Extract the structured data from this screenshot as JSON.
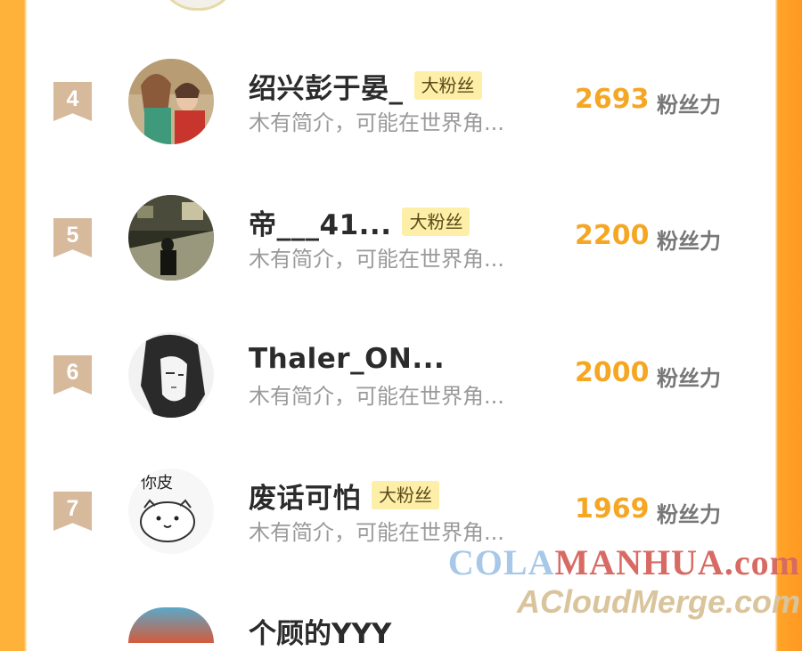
{
  "rows": [
    {
      "rank": "4",
      "name": "绍兴彭于晏_",
      "badge": "大粉丝",
      "bio": "木有简介，可能在世界角...",
      "score": "2693",
      "unit": "粉丝力",
      "avatar": "couple-photo"
    },
    {
      "rank": "5",
      "name": "帝___41...",
      "badge": "大粉丝",
      "bio": "木有简介，可能在世界角...",
      "score": "2200",
      "unit": "粉丝力",
      "avatar": "street-photo"
    },
    {
      "rank": "6",
      "name": "Thaler_ON...",
      "badge": "",
      "bio": "木有简介，可能在世界角...",
      "score": "2000",
      "unit": "粉丝力",
      "avatar": "anime-sketch"
    },
    {
      "rank": "7",
      "name": "废话可怕",
      "badge": "大粉丝",
      "bio": "木有简介，可能在世界角...",
      "score": "1969",
      "unit": "粉丝力",
      "avatar": "cat-doodle"
    }
  ],
  "partial_row": {
    "name": "个顾的YYY"
  },
  "avatar_text": {
    "cat_doodle": "你皮"
  },
  "watermark": {
    "line1_a": "COLA",
    "line1_b": "MANHUA.com",
    "line2": "ACloudMerge.com"
  },
  "colors": {
    "score": "#f5a623",
    "badge_bg": "#fdeea8",
    "rank_ribbon": "#d7b99c",
    "side_accent": "#ffa42a"
  }
}
